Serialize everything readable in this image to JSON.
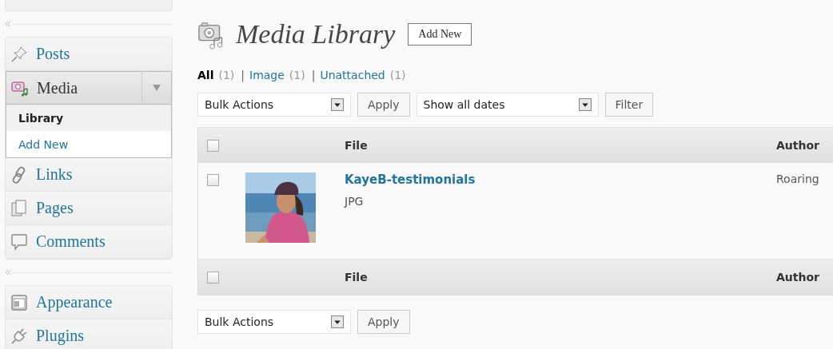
{
  "sidebar": {
    "groups": [
      {
        "items": [
          {
            "label": "Posts",
            "selected": false
          },
          {
            "label": "Media",
            "selected": true,
            "expanded": true,
            "children": [
              {
                "label": "Library",
                "selected": true
              },
              {
                "label": "Add New",
                "selected": false
              }
            ]
          },
          {
            "label": "Links",
            "selected": false
          },
          {
            "label": "Pages",
            "selected": false
          },
          {
            "label": "Comments",
            "selected": false
          }
        ]
      },
      {
        "items": [
          {
            "label": "Appearance",
            "selected": false
          },
          {
            "label": "Plugins",
            "selected": false
          }
        ]
      }
    ]
  },
  "page": {
    "title": "Media Library",
    "add_new_button": "Add New"
  },
  "filters": [
    {
      "label": "All",
      "count": "(1)",
      "selected": true
    },
    {
      "label": "Image",
      "count": "(1)",
      "selected": false
    },
    {
      "label": "Unattached",
      "count": "(1)",
      "selected": false
    }
  ],
  "filter_separator": "|",
  "top_toolbar": {
    "bulk_actions": "Bulk Actions",
    "apply_button": "Apply",
    "date_filter": "Show all dates",
    "filter_button": "Filter"
  },
  "table": {
    "header": {
      "checked": false,
      "columns": [
        "File",
        "Author"
      ]
    },
    "rows": [
      {
        "checked": false,
        "title": "KayeB-testimonials",
        "file_type": "JPG",
        "author": "Roaring"
      }
    ],
    "footer": {
      "checked": false,
      "columns": [
        "File",
        "Author"
      ]
    }
  },
  "bottom_toolbar": {
    "bulk_actions": "Bulk Actions",
    "apply_button": "Apply"
  }
}
